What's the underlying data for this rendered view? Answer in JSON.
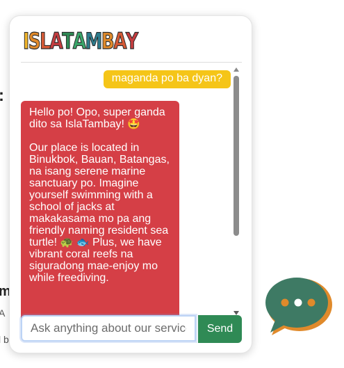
{
  "background": {
    "fragment_colon": ":",
    "fragment_m": "m",
    "fragment_a": "A",
    "fragment_b": "l b"
  },
  "header": {
    "logo_text": "ISLATAMBAY",
    "logo_letters": [
      {
        "char": "I",
        "color": "#f1b52a"
      },
      {
        "char": "S",
        "color": "#e08a2b"
      },
      {
        "char": "L",
        "color": "#d65a36"
      },
      {
        "char": "A",
        "color": "#c43d3f"
      },
      {
        "char": "T",
        "color": "#2f8a55"
      },
      {
        "char": "A",
        "color": "#3aa56a"
      },
      {
        "char": "M",
        "color": "#2e7d8e"
      },
      {
        "char": "B",
        "color": "#e08a2b"
      },
      {
        "char": "A",
        "color": "#d65a36"
      },
      {
        "char": "Y",
        "color": "#c43d3f"
      }
    ]
  },
  "messages": {
    "user_message": "maganda po ba dyan?",
    "bot_paragraph_1": "Hello po! Opo, super ganda dito sa IslaTambay!",
    "bot_emoji_1": "🤩",
    "bot_paragraph_2": "Our place is located in Binukbok, Bauan, Batangas, na isang serene marine sanctuary po. Imagine yourself swimming with a school of jacks at makakasama mo pa ang friendly naming resident sea turtle!",
    "bot_emoji_2": "🐢 🐟",
    "bot_paragraph_2b": "Plus, we have vibrant coral reefs na siguradong mae-enjoy mo while freediving."
  },
  "input": {
    "placeholder": "Ask anything about our services",
    "value": ""
  },
  "send_label": "Send",
  "colors": {
    "user_bubble": "#f5c518",
    "bot_bubble": "#d53f46",
    "send_button": "#2f8a55",
    "fab_bubble": "#3e7a64",
    "fab_shadow": "#e08a2b",
    "fab_dots": "#e08a2b"
  },
  "icons": {
    "fab": "chat-bubble-icon",
    "scroll_up": "scroll-up-arrow-icon",
    "scroll_down": "scroll-down-arrow-icon"
  }
}
